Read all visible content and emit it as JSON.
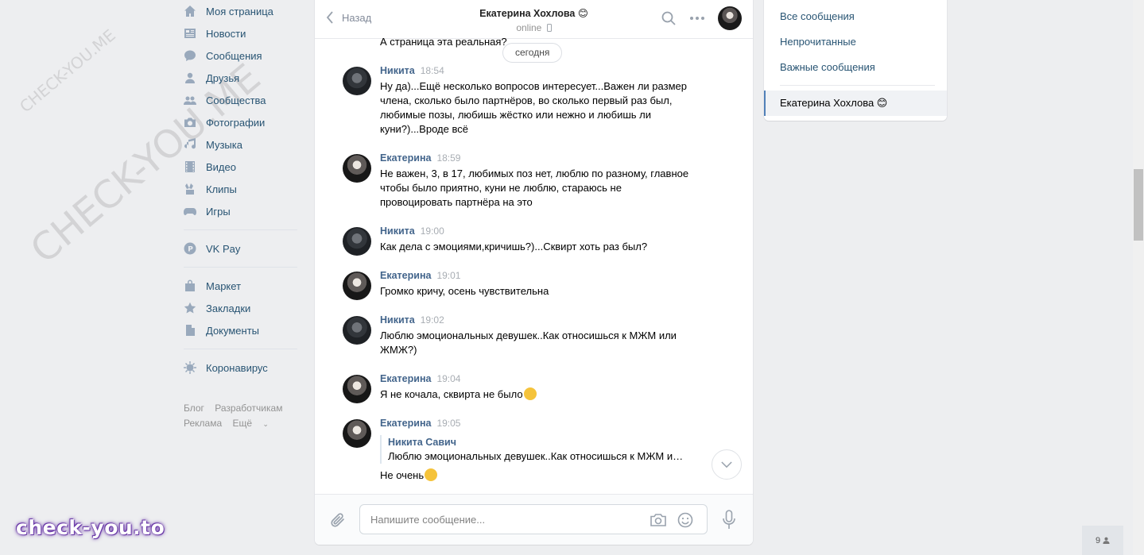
{
  "watermark": {
    "small": "CHECK-YOU.ME",
    "large": "CHECK-YOU.ME",
    "bottom": "check-you.to"
  },
  "leftnav": {
    "items": [
      {
        "label": "Моя страница",
        "icon": "home-icon"
      },
      {
        "label": "Новости",
        "icon": "news-icon"
      },
      {
        "label": "Сообщения",
        "icon": "messages-icon"
      },
      {
        "label": "Друзья",
        "icon": "friends-icon"
      },
      {
        "label": "Сообщества",
        "icon": "communities-icon"
      },
      {
        "label": "Фотографии",
        "icon": "camera-icon"
      },
      {
        "label": "Музыка",
        "icon": "music-icon"
      },
      {
        "label": "Видео",
        "icon": "video-icon"
      },
      {
        "label": "Клипы",
        "icon": "clips-icon"
      },
      {
        "label": "Игры",
        "icon": "gamepad-icon"
      }
    ],
    "vkpay": "VK Pay",
    "items2": [
      {
        "label": "Маркет"
      },
      {
        "label": "Закладки"
      },
      {
        "label": "Документы"
      }
    ],
    "corona": "Коронавирус",
    "footer": {
      "blog": "Блог",
      "dev": "Разработчикам",
      "ads": "Реклама",
      "more": "Ещё"
    }
  },
  "chat": {
    "back": "Назад",
    "peer_name": "Екатерина Хохлова 😊",
    "peer_status": "online",
    "date_pill": "сегодня",
    "top_cut": "А страница эта реальная?",
    "messages": [
      {
        "author": "Никита",
        "time": "18:54",
        "text": "Ну да)...Ещё несколько вопросов интересует...Важен ли размер члена, сколько было партнёров, во сколько первый раз был, любимые позы, любишь жёстко или нежно и любишь ли куни?)...Вроде всё"
      },
      {
        "author": "Екатерина",
        "time": "18:59",
        "text": "Не важен, 3, в 17, любимых поз нет, люблю по разному, главное чтобы было приятно, куни не люблю, стараюсь не провоцировать партнёра на это"
      },
      {
        "author": "Никита",
        "time": "19:00",
        "text": "Как дела с эмоциями,кричишь?)...Сквирт хоть раз был?"
      },
      {
        "author": "Екатерина",
        "time": "19:01",
        "text": "Громко кричу, осень чувствительна"
      },
      {
        "author": "Никита",
        "time": "19:02",
        "text": "Люблю эмоциональных девушек..Как относишься к МЖМ или ЖМЖ?)"
      },
      {
        "author": "Екатерина",
        "time": "19:04",
        "text": "Я не кочала, сквирта не было"
      },
      {
        "author": "Екатерина",
        "time": "19:05",
        "fwd_author": "Никита Савич",
        "fwd_text": "Люблю эмоциональных девушек..Как относишься к МЖМ или ЖМЖ?)",
        "text": "Не очень"
      }
    ],
    "composer_placeholder": "Напишите сообщение..."
  },
  "rightpanel": {
    "all": "Все сообщения",
    "unread": "Непрочитанные",
    "important": "Важные сообщения",
    "active": "Екатерина Хохлова 😊"
  },
  "counter": "9"
}
